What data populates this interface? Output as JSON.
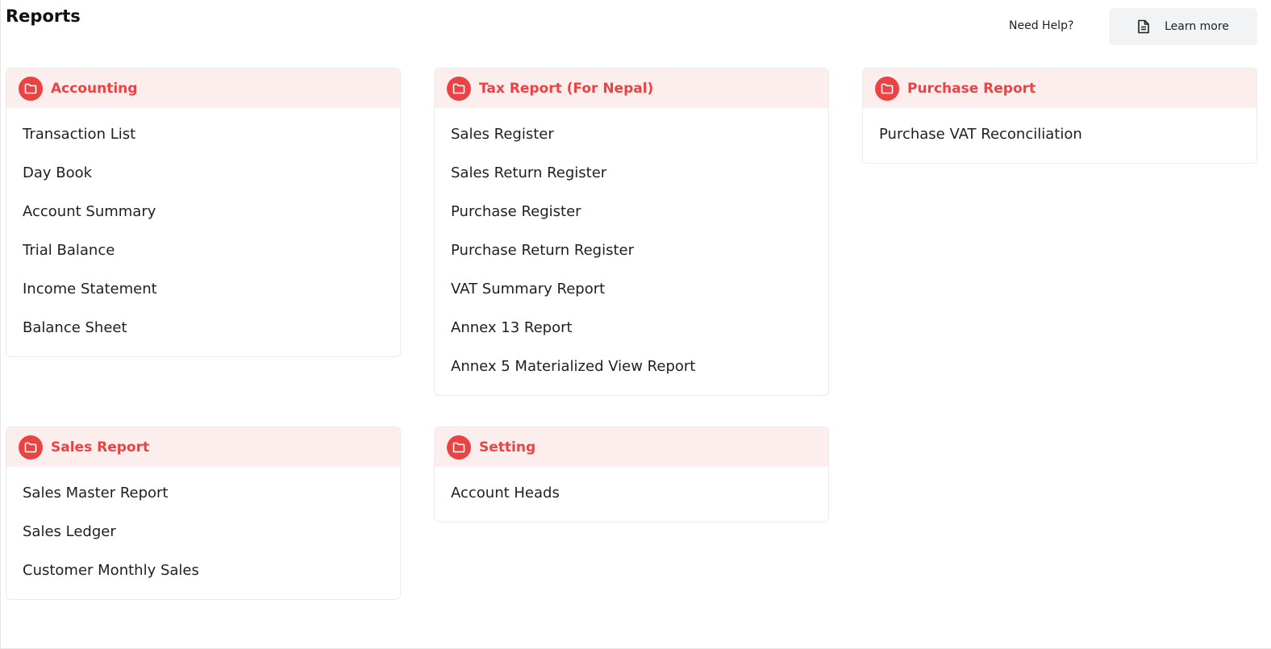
{
  "page": {
    "title": "Reports"
  },
  "header": {
    "help_text": "Need Help?",
    "learn_more_label": "Learn more",
    "learn_more_icon": "document-icon"
  },
  "colors": {
    "accent": "#ea4343",
    "card_header_bg": "#fdeeee",
    "button_bg": "#f2f3f5"
  },
  "cards": [
    {
      "title": "Accounting",
      "icon": "folder-icon",
      "items": [
        "Transaction List",
        "Day Book",
        "Account Summary",
        "Trial Balance",
        "Income Statement",
        "Balance Sheet"
      ]
    },
    {
      "title": "Tax Report (For Nepal)",
      "icon": "folder-icon",
      "items": [
        "Sales Register",
        "Sales Return Register",
        "Purchase Register",
        "Purchase Return Register",
        "VAT Summary Report",
        "Annex 13 Report",
        "Annex 5 Materialized View Report"
      ]
    },
    {
      "title": "Purchase Report",
      "icon": "folder-icon",
      "items": [
        "Purchase VAT Reconciliation"
      ]
    },
    {
      "title": "Sales Report",
      "icon": "folder-icon",
      "items": [
        "Sales Master Report",
        "Sales Ledger",
        "Customer Monthly Sales"
      ]
    },
    {
      "title": "Setting",
      "icon": "folder-icon",
      "items": [
        "Account Heads"
      ]
    }
  ]
}
